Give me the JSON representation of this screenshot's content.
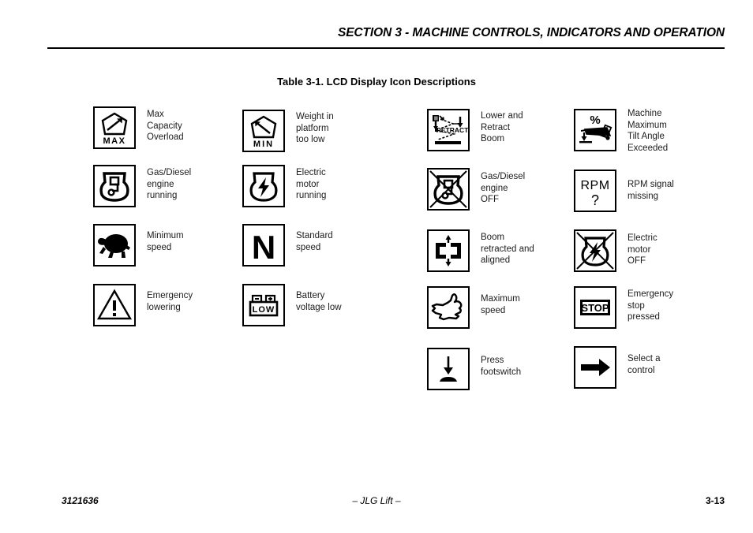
{
  "header": {
    "section_title": "SECTION 3 - MACHINE CONTROLS, INDICATORS AND OPERATION"
  },
  "table": {
    "caption": "Table 3-1.  LCD Display Icon Descriptions",
    "columns": [
      {
        "index": 1,
        "entries": [
          {
            "icon": "max-capacity-overload-icon",
            "icon_text": "MAX",
            "label": "Max\nCapacity\nOverload"
          },
          {
            "icon": "gas-diesel-engine-running-icon",
            "icon_text": "",
            "label": "Gas/Diesel\nengine\nrunning"
          },
          {
            "icon": "turtle-minimum-speed-icon",
            "icon_text": "",
            "label": "Minimum\nspeed"
          },
          {
            "icon": "warning-triangle-emergency-lowering-icon",
            "icon_text": "",
            "label": "Emergency\nlowering"
          }
        ]
      },
      {
        "index": 2,
        "entries": [
          {
            "icon": "min-weight-platform-icon",
            "icon_text": "MIN",
            "label": "Weight in\nplatform\ntoo low"
          },
          {
            "icon": "electric-motor-running-icon",
            "icon_text": "",
            "label": "Electric\nmotor\nrunning"
          },
          {
            "icon": "standard-speed-n-icon",
            "icon_text": "N",
            "label": "Standard\nspeed"
          },
          {
            "icon": "battery-voltage-low-icon",
            "icon_text": "LOW",
            "label": "Battery\nvoltage low"
          }
        ]
      },
      {
        "index": 3,
        "entries": [
          {
            "icon": "lower-and-retract-boom-icon",
            "icon_text": "RETRACT",
            "label": "Lower and\nRetract\nBoom"
          },
          {
            "icon": "gas-diesel-engine-off-icon",
            "icon_text": "",
            "label": "Gas/Diesel\nengine\nOFF"
          },
          {
            "icon": "boom-retracted-aligned-icon",
            "icon_text": "",
            "label": "Boom\nretracted and\naligned"
          },
          {
            "icon": "rabbit-maximum-speed-icon",
            "icon_text": "",
            "label": "Maximum\nspeed"
          },
          {
            "icon": "press-footswitch-icon",
            "icon_text": "",
            "label": "Press\nfootswitch"
          }
        ]
      },
      {
        "index": 4,
        "entries": [
          {
            "icon": "machine-max-tilt-angle-icon",
            "icon_text": "%",
            "label": "Machine\nMaximum\nTilt Angle\nExceeded"
          },
          {
            "icon": "rpm-signal-missing-icon",
            "icon_text": "RPM ?",
            "label": "RPM signal\nmissing"
          },
          {
            "icon": "electric-motor-off-icon",
            "icon_text": "",
            "label": "Electric\nmotor\nOFF"
          },
          {
            "icon": "emergency-stop-pressed-icon",
            "icon_text": "STOP",
            "label": "Emergency\nstop\npressed"
          },
          {
            "icon": "select-a-control-arrow-icon",
            "icon_text": "",
            "label": "Select a\ncontrol"
          }
        ]
      }
    ]
  },
  "footer": {
    "document_number": "3121636",
    "center": "– JLG Lift –",
    "page_number": "3-13"
  }
}
